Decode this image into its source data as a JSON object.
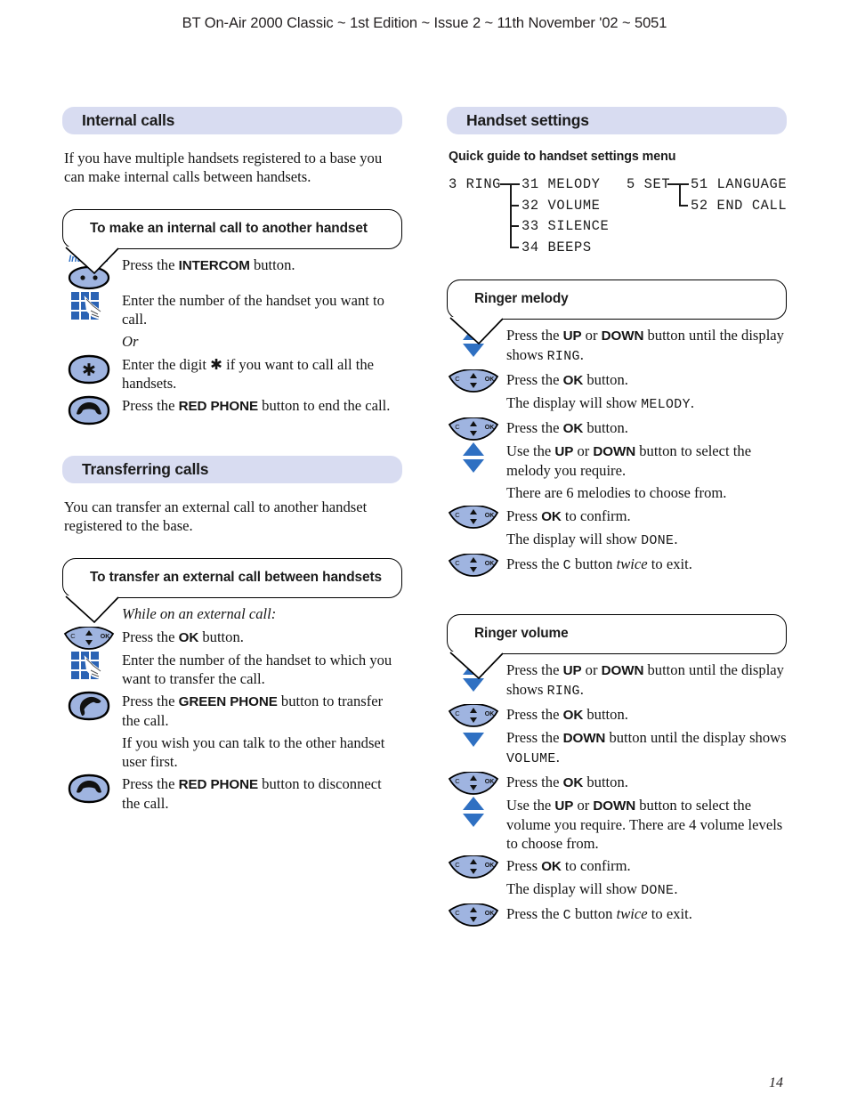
{
  "running_head": "BT On-Air 2000 Classic ~ 1st Edition ~ Issue 2 ~ 11th November '02 ~ 5051",
  "page_number": "14",
  "colors": {
    "section_bar": "#d8dcf1",
    "icon_gutter": "#d6d6d6",
    "button_blue": "#9fb4e0",
    "arrow_blue": "#2f70c2",
    "keypad_blue": "#2b63b4",
    "intercom_label": "#2e6fc4"
  },
  "left_column": {
    "sections": [
      {
        "title": "Internal calls",
        "intro": "If you have multiple handsets registered to a base you can make internal calls between handsets.",
        "procedure": {
          "balloon_title": "To make an internal call to another handset",
          "steps": [
            {
              "icon": "intercom-button-icon",
              "icon_label": "Intercom",
              "text_html": "Press the <b>INTERCOM</b> button."
            },
            {
              "icon": "keypad-icon",
              "text_html": "Enter the number of the handset you want to call."
            },
            {
              "icon": "none",
              "text_html": "<i>Or</i>"
            },
            {
              "icon": "star-button-icon",
              "text_html": "Enter the digit &#10033; if you want to call all the handsets."
            },
            {
              "icon": "red-phone-icon",
              "text_html": "Press the <b>RED PHONE</b> button to end the call."
            }
          ]
        }
      },
      {
        "title": "Transferring calls",
        "intro": "You can transfer an external call to another handset registered to the base.",
        "procedure": {
          "balloon_title": "To transfer an external call between handsets",
          "steps": [
            {
              "icon": "none",
              "text_html": "<i>While on an external call:</i>"
            },
            {
              "icon": "nav-button-icon",
              "text_html": "Press the <b>OK</b> button."
            },
            {
              "icon": "keypad-icon",
              "text_html": "Enter the number of the handset to which you want to transfer the call."
            },
            {
              "icon": "green-phone-icon",
              "text_html": "Press the <b>GREEN PHONE</b> button to transfer the call."
            },
            {
              "icon": "none",
              "text_html": "If you wish you can talk to the other handset user first."
            },
            {
              "icon": "red-phone-icon",
              "text_html": "Press the <b>RED PHONE</b> button to disconnect the call."
            }
          ]
        }
      }
    ]
  },
  "right_column": {
    "section_title": "Handset settings",
    "quick_guide_heading": "Quick guide to handset settings menu",
    "menu_tree": {
      "groups": [
        {
          "root": "3 RING",
          "items": [
            "31 MELODY",
            "32 VOLUME",
            "33 SILENCE",
            "34 BEEPS"
          ]
        },
        {
          "root": "5 SET",
          "items": [
            "51 LANGUAGE",
            "52 END CALL"
          ]
        }
      ]
    },
    "procedures": [
      {
        "balloon_title": "Ringer melody",
        "steps": [
          {
            "icon": "up-down-arrows-icon",
            "text_html": "Press the <b>UP</b> or <b>DOWN</b> button until the display shows <span class=\"lcd\">RING</span>."
          },
          {
            "icon": "nav-button-icon",
            "text_html": "Press the <b>OK</b> button."
          },
          {
            "icon": "none",
            "text_html": "The display will show <span class=\"lcd\">MELODY</span>."
          },
          {
            "icon": "nav-button-icon",
            "text_html": "Press the <b>OK</b> button."
          },
          {
            "icon": "up-down-arrows-icon",
            "text_html": "Use the <b>UP</b> or <b>DOWN</b> button to select the melody you require."
          },
          {
            "icon": "none",
            "text_html": "There are 6 melodies to choose from."
          },
          {
            "icon": "nav-button-icon",
            "text_html": "Press <b>OK</b> to confirm."
          },
          {
            "icon": "none",
            "text_html": "The display will show <span class=\"lcd\">DONE</span>."
          },
          {
            "icon": "nav-button-icon",
            "text_html": "Press the <span class=\"lcd\">C</span> button <i>twice</i> to exit."
          }
        ]
      },
      {
        "balloon_title": "Ringer volume",
        "steps": [
          {
            "icon": "up-down-arrows-icon",
            "text_html": "Press the <b>UP</b> or <b>DOWN</b> button until the display shows <span class=\"lcd\">RING</span>."
          },
          {
            "icon": "nav-button-icon",
            "text_html": "Press the <b>OK</b> button."
          },
          {
            "icon": "down-arrow-icon",
            "text_html": "Press the <b>DOWN</b> button until the display shows <span class=\"lcd\">VOLUME</span>."
          },
          {
            "icon": "nav-button-icon",
            "text_html": "Press the <b>OK</b> button."
          },
          {
            "icon": "up-down-arrows-icon",
            "text_html": "Use the <b>UP</b> or <b>DOWN</b> button to select the volume you require. There are 4 volume levels to choose from."
          },
          {
            "icon": "nav-button-icon",
            "text_html": "Press <b>OK</b> to confirm."
          },
          {
            "icon": "none",
            "text_html": "The display will show <span class=\"lcd\">DONE</span>."
          },
          {
            "icon": "nav-button-icon",
            "text_html": "Press the <span class=\"lcd\">C</span> button <i>twice</i> to exit."
          }
        ]
      }
    ]
  }
}
